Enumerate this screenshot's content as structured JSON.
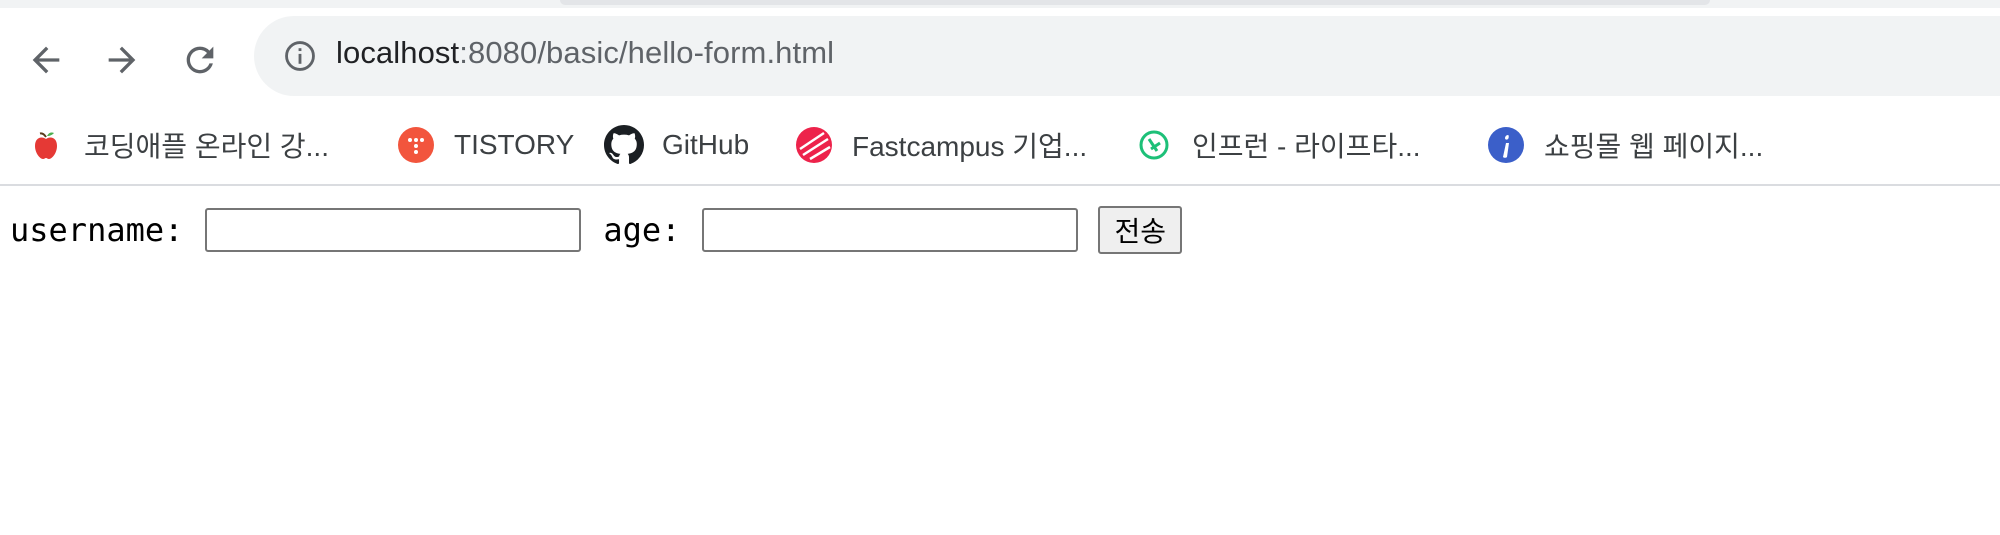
{
  "browser": {
    "url_host": "localhost",
    "url_path": ":8080/basic/hello-form.html",
    "bookmarks": [
      {
        "label": "코딩애플 온라인 강...",
        "icon": "apple-icon",
        "color": "#e53935"
      },
      {
        "label": "TISTORY",
        "icon": "tistory-icon",
        "color": "#f2553d"
      },
      {
        "label": "GitHub",
        "icon": "github-icon",
        "color": "#1b1f23"
      },
      {
        "label": "Fastcampus 기업...",
        "icon": "fastcampus-icon",
        "color": "#ed234b"
      },
      {
        "label": "인프런 - 라이프타...",
        "icon": "inflearn-icon",
        "color": "#1dc078"
      },
      {
        "label": "쇼핑몰 웹 페이지...",
        "icon": "info-circle-icon",
        "color": "#3b5fc9"
      }
    ]
  },
  "form": {
    "username_label": "username:",
    "username_value": "",
    "age_label": "age:",
    "age_value": "",
    "submit_label": "전송"
  }
}
